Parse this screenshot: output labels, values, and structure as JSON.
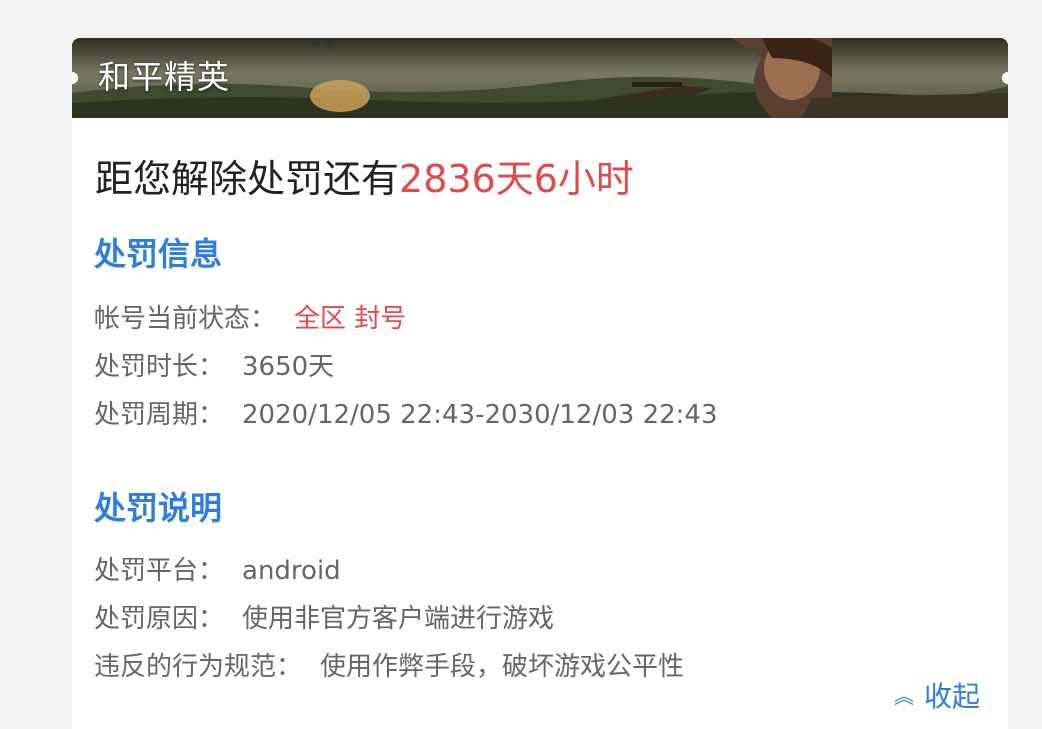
{
  "banner": {
    "game_title": "和平精英"
  },
  "countdown": {
    "prefix": "距您解除处罚还有",
    "remaining": "2836天6小时"
  },
  "penalty_info": {
    "title": "处罚信息",
    "rows": [
      {
        "label": "帐号当前状态：",
        "value": "全区 封号",
        "highlight": true
      },
      {
        "label": "处罚时长：",
        "value": "3650天"
      },
      {
        "label": "处罚周期：",
        "value": "2020/12/05 22:43-2030/12/03 22:43"
      }
    ]
  },
  "penalty_desc": {
    "title": "处罚说明",
    "rows": [
      {
        "label": "处罚平台：",
        "value": "android"
      },
      {
        "label": "处罚原因：",
        "value": "使用非官方客户端进行游戏"
      },
      {
        "label": "违反的行为规范：",
        "value": "使用作弊手段，破坏游戏公平性"
      }
    ]
  },
  "collapse_button": {
    "label": "收起",
    "icon": "double-chevron-up-icon"
  },
  "colors": {
    "accent": "#2f7de1",
    "alert": "#e04a4a",
    "text": "#666666"
  }
}
